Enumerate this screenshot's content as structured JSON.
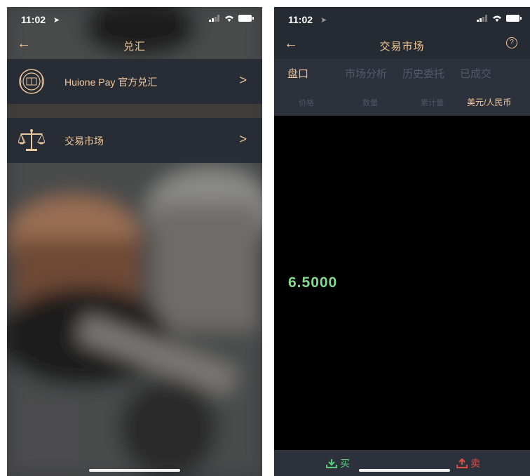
{
  "left": {
    "status": {
      "time": "11:02"
    },
    "nav": {
      "title": "兑汇"
    },
    "rows": [
      {
        "label": "Huione Pay 官方兑汇",
        "icon": "huione-seal-icon",
        "arrow": ">"
      },
      {
        "label": "交易市场",
        "icon": "scales-icon",
        "arrow": ">"
      }
    ]
  },
  "right": {
    "status": {
      "time": "11:02"
    },
    "nav": {
      "title": "交易市场",
      "help": "?"
    },
    "tabs": [
      "盘口",
      "市场分析",
      "历史委托",
      "已成交"
    ],
    "columns": [
      "价格",
      "数量",
      "累计量",
      "美元/人民币"
    ],
    "price": "6.5000",
    "bottom": {
      "buy": "买",
      "sell": "卖"
    }
  },
  "colors": {
    "accent": "#f0c89a",
    "buy": "#59c67a",
    "sell": "#d84e44",
    "price": "#86d88f"
  }
}
